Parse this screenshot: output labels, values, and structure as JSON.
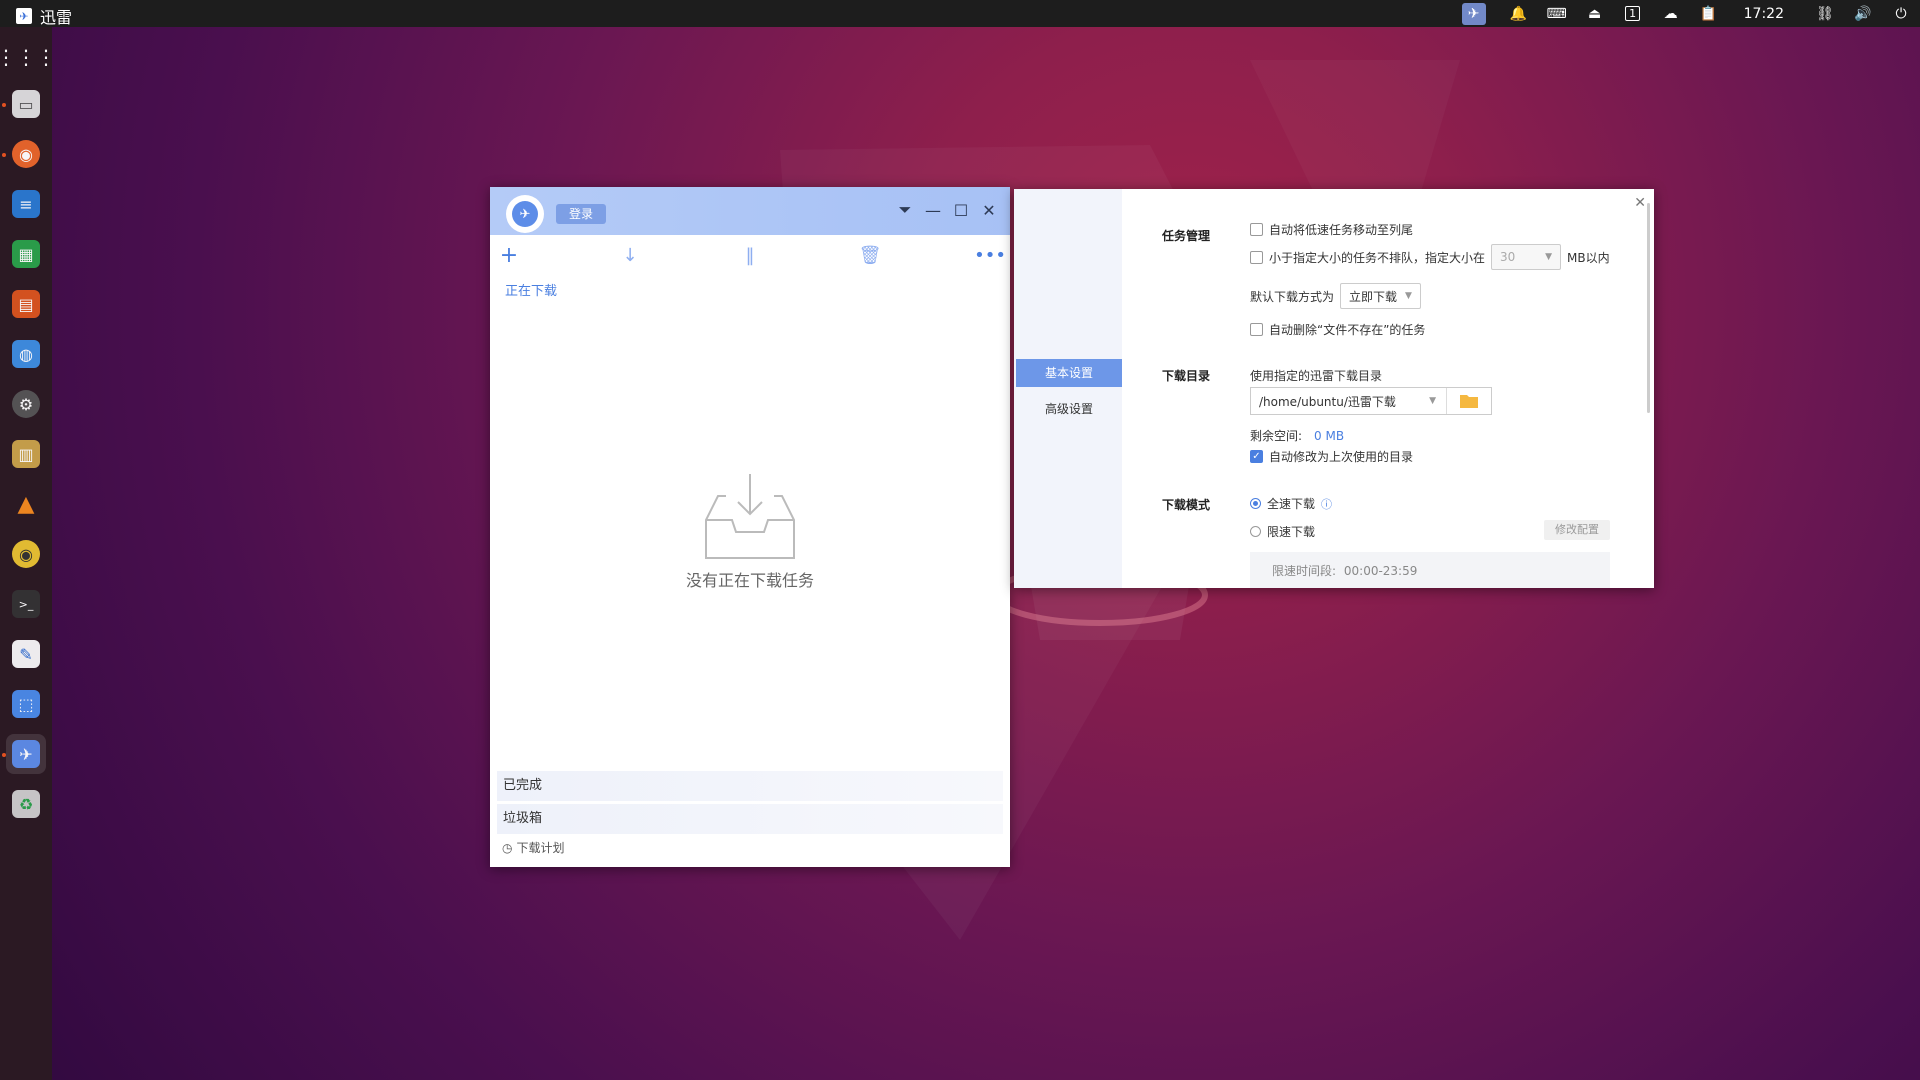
{
  "topbar": {
    "app_name": "迅雷",
    "clock": "17:22",
    "tray_icons": [
      "thunder-icon",
      "bell-icon",
      "keyboard-icon",
      "eject-icon",
      "workspace-1-icon",
      "cloud-icon",
      "clipboard-icon",
      "network-icon",
      "volume-icon",
      "power-icon"
    ],
    "workspace_num": "1"
  },
  "dock": {
    "items": [
      "app-grid-icon",
      "files-icon",
      "firefox-icon",
      "writer-icon",
      "calc-icon",
      "impress-icon",
      "software-center-icon",
      "settings-icon",
      "archive-icon",
      "vlc-icon",
      "rhythmbox-icon",
      "terminal-icon",
      "text-editor-icon",
      "screenshot-icon",
      "thunder-icon",
      "trash-icon"
    ]
  },
  "main": {
    "login_label": "登录",
    "tab_downloading": "正在下载",
    "empty_text": "没有正在下载任务",
    "completed": "已完成",
    "trash": "垃圾箱",
    "schedule": "下载计划"
  },
  "settings": {
    "nav": [
      "基本设置",
      "高级设置"
    ],
    "task_mgmt": {
      "heading": "任务管理",
      "opt1": "自动将低速任务移动至列尾",
      "opt2": "小于指定大小的任务不排队，指定大小在",
      "size_value": "30",
      "size_unit": "MB以内",
      "default_mode_label": "默认下载方式为",
      "default_mode_value": "立即下载",
      "opt3": "自动删除“文件不存在”的任务"
    },
    "download_dir": {
      "heading": "下载目录",
      "use_label": "使用指定的迅雷下载目录",
      "path": "/home/ubuntu/迅雷下载",
      "free_label": "剩余空间:",
      "free_value": "0 MB",
      "auto_modify": "自动修改为上次使用的目录"
    },
    "download_mode": {
      "heading": "下载模式",
      "full_speed": "全速下载",
      "limited": "限速下载",
      "modify_btn": "修改配置",
      "limit_time_label": "限速时间段:",
      "limit_time_value": "00:00-23:59"
    }
  },
  "colors": {
    "accent": "#4a7fe0",
    "titlebar": "#a7c1f5",
    "nav_active": "#6d97e8"
  }
}
